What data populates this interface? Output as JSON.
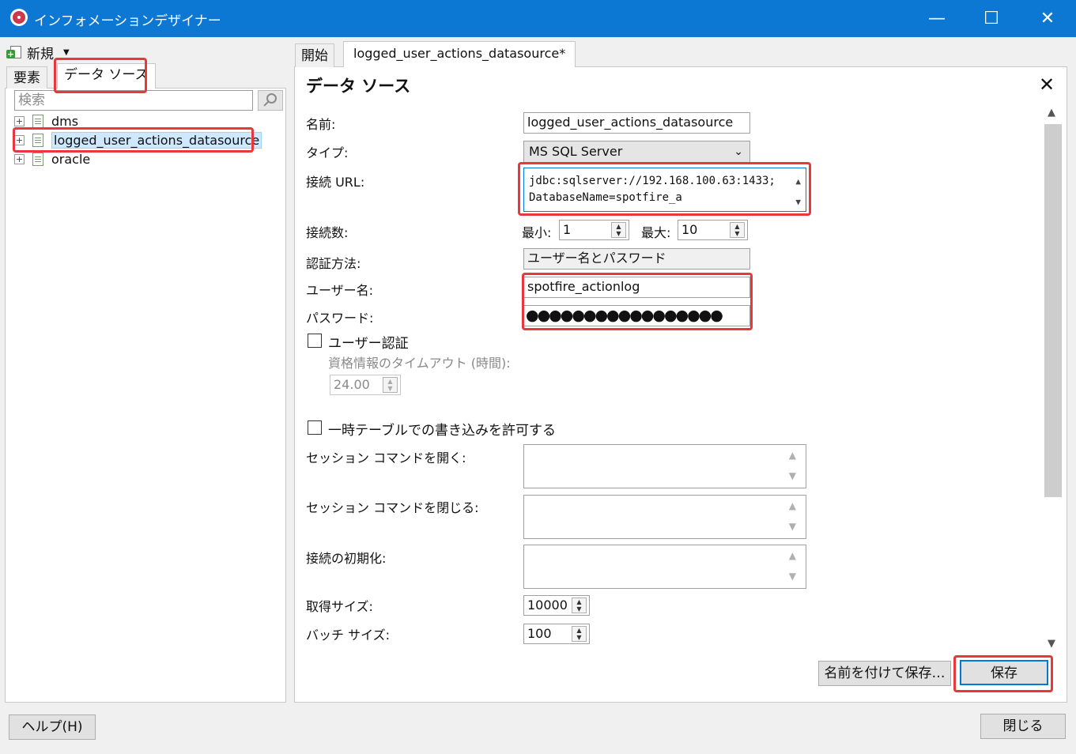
{
  "window": {
    "title": "インフォメーションデザイナー",
    "minimize": "—",
    "maximize": "☐",
    "close": "✕"
  },
  "toolbar": {
    "new_label": "新規",
    "new_caret": "▼"
  },
  "left": {
    "tabs": [
      "要素",
      "データ ソース"
    ],
    "search_placeholder": "検索",
    "tree": [
      {
        "label": "dms"
      },
      {
        "label": "logged_user_actions_datasource"
      },
      {
        "label": "oracle"
      }
    ]
  },
  "right": {
    "tabs": [
      "開始",
      "logged_user_actions_datasource*"
    ],
    "section_title": "データ ソース",
    "close_glyph": "✕",
    "labels": {
      "name": "名前:",
      "type": "タイプ:",
      "url": "接続 URL:",
      "connections": "接続数:",
      "min": "最小:",
      "max": "最大:",
      "auth": "認証方法:",
      "username": "ユーザー名:",
      "password": "パスワード:",
      "user_auth": "ユーザー認証",
      "cred_timeout": "資格情報のタイムアウト (時間):",
      "temp_tables": "一時テーブルでの書き込みを許可する",
      "open_session": "セッション コマンドを開く:",
      "close_session": "セッション コマンドを閉じる:",
      "init": "接続の初期化:",
      "fetch_size": "取得サイズ:",
      "batch_size": "バッチ サイズ:"
    },
    "values": {
      "name": "logged_user_actions_datasource",
      "type": "MS SQL Server",
      "url": "jdbc:sqlserver://192.168.100.63:1433;DatabaseName=spotfire_a",
      "min": "1",
      "max": "10",
      "auth": "ユーザー名とパスワード",
      "username": "spotfire_actionlog",
      "password": "●●●●●●●●●●●●●●●●●",
      "timeout": "24.00",
      "fetch_size": "10000",
      "batch_size": "100"
    },
    "buttons": {
      "save_as": "名前を付けて保存…",
      "save": "保存"
    }
  },
  "footer": {
    "help": "ヘルプ(H)",
    "close": "閉じる"
  }
}
